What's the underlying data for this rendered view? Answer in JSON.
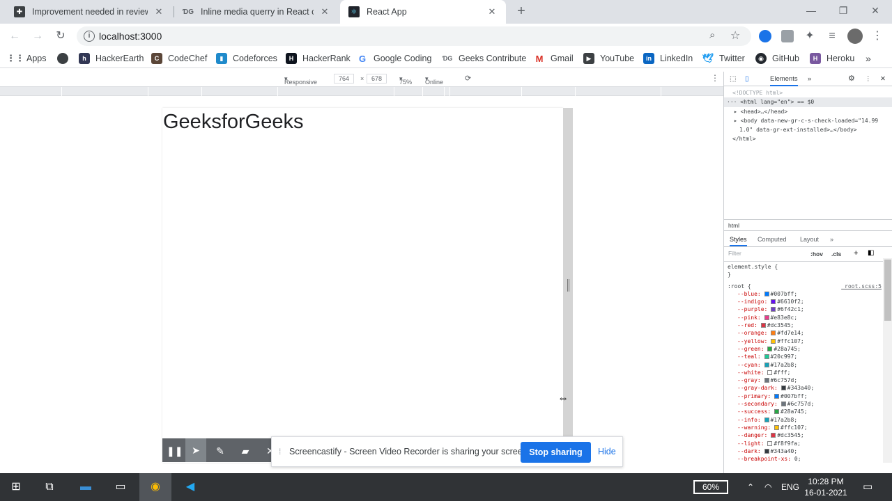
{
  "browser": {
    "tabs": [
      {
        "title": "Improvement needed in reviewed"
      },
      {
        "title": "Inline media querry in React com"
      },
      {
        "title": "React App"
      }
    ],
    "url": "localhost:3000"
  },
  "bookmarks": [
    {
      "label": "Apps"
    },
    {
      "label": ""
    },
    {
      "label": "HackerEarth"
    },
    {
      "label": "CodeChef"
    },
    {
      "label": "Codeforces"
    },
    {
      "label": "HackerRank"
    },
    {
      "label": "Google Coding"
    },
    {
      "label": "Geeks Contribute"
    },
    {
      "label": "Gmail"
    },
    {
      "label": "YouTube"
    },
    {
      "label": "LinkedIn"
    },
    {
      "label": "Twitter"
    },
    {
      "label": "GitHub"
    },
    {
      "label": "Heroku"
    }
  ],
  "device_toolbar": {
    "mode": "Responsive",
    "width": "764",
    "height": "678",
    "zoom": "75%",
    "network": "Online"
  },
  "page": {
    "heading": "GeeksforGeeks"
  },
  "screencastify": {
    "message": "Screencastify - Screen Video Recorder is sharing your screen.",
    "stop_label": "Stop sharing",
    "hide_label": "Hide"
  },
  "devtools": {
    "panel_tab": "Elements",
    "dom": {
      "doctype": "<!DOCTYPE html>",
      "html_open": "<html lang=\"en\"> == $0",
      "head": "<head>…</head>",
      "body_a": "<body data-new-gr-c-s-check-loaded=\"14.99",
      "body_b": "1.0\" data-gr-ext-installed>…</body>",
      "html_close": "</html>"
    },
    "breadcrumb": "html",
    "subtabs": [
      "Styles",
      "Computed",
      "Layout"
    ],
    "filter_placeholder": "Filter",
    "hov": ":hov",
    "cls": ".cls",
    "element_style": "element.style {",
    "root_selector": ":root {",
    "root_source": "_root.scss:5",
    "vars": [
      {
        "name": "--blue:",
        "value": "#007bff;",
        "color": "#007bff"
      },
      {
        "name": "--indigo:",
        "value": "#6610f2;",
        "color": "#6610f2"
      },
      {
        "name": "--purple:",
        "value": "#6f42c1;",
        "color": "#6f42c1"
      },
      {
        "name": "--pink:",
        "value": "#e83e8c;",
        "color": "#e83e8c"
      },
      {
        "name": "--red:",
        "value": "#dc3545;",
        "color": "#dc3545"
      },
      {
        "name": "--orange:",
        "value": "#fd7e14;",
        "color": "#fd7e14"
      },
      {
        "name": "--yellow:",
        "value": "#ffc107;",
        "color": "#ffc107"
      },
      {
        "name": "--green:",
        "value": "#28a745;",
        "color": "#28a745"
      },
      {
        "name": "--teal:",
        "value": "#20c997;",
        "color": "#20c997"
      },
      {
        "name": "--cyan:",
        "value": "#17a2b8;",
        "color": "#17a2b8"
      },
      {
        "name": "--white:",
        "value": "#fff;",
        "color": "#ffffff"
      },
      {
        "name": "--gray:",
        "value": "#6c757d;",
        "color": "#6c757d"
      },
      {
        "name": "--gray-dark:",
        "value": "#343a40;",
        "color": "#343a40"
      },
      {
        "name": "--primary:",
        "value": "#007bff;",
        "color": "#007bff"
      },
      {
        "name": "--secondary:",
        "value": "#6c757d;",
        "color": "#6c757d"
      },
      {
        "name": "--success:",
        "value": "#28a745;",
        "color": "#28a745"
      },
      {
        "name": "--info:",
        "value": "#17a2b8;",
        "color": "#17a2b8"
      },
      {
        "name": "--warning:",
        "value": "#ffc107;",
        "color": "#ffc107"
      },
      {
        "name": "--danger:",
        "value": "#dc3545;",
        "color": "#dc3545"
      },
      {
        "name": "--light:",
        "value": "#f8f9fa;",
        "color": "#f8f9fa"
      },
      {
        "name": "--dark:",
        "value": "#343a40;",
        "color": "#343a40"
      },
      {
        "name": "--breakpoint-xs:",
        "value": "0;",
        "color": ""
      }
    ]
  },
  "taskbar": {
    "battery": "60%",
    "language": "ENG",
    "time": "10:28 PM",
    "date": "16-01-2021"
  },
  "colors": {
    "accent": "#1a73e8",
    "tabstrip": "#dee1e6",
    "taskbar": "#303336"
  }
}
